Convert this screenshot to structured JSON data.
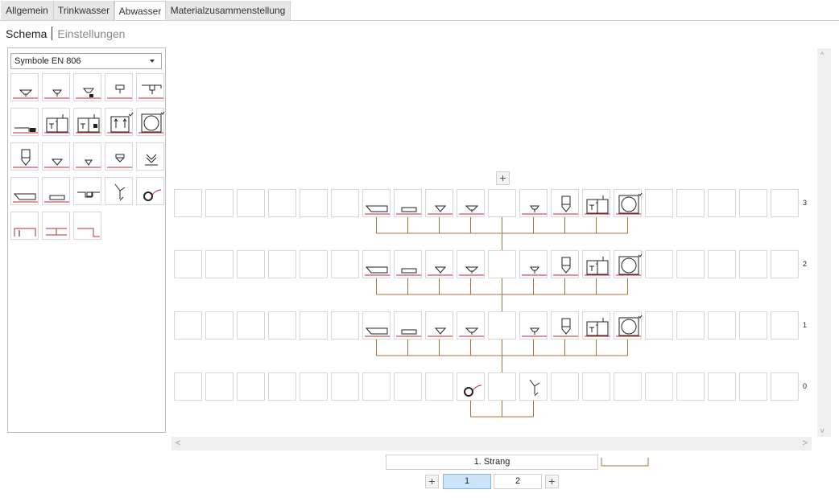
{
  "tabs": [
    {
      "label": "Allgemein",
      "active": false
    },
    {
      "label": "Trinkwasser",
      "active": false
    },
    {
      "label": "Abwasser",
      "active": true
    },
    {
      "label": "Materialzusammenstellung",
      "active": false
    }
  ],
  "subnav": {
    "current": "Schema",
    "other": "Einstellungen"
  },
  "palette": {
    "dropdown_value": "Symbole EN 806",
    "symbols": [
      [
        "washbasin-symbol",
        "small-washbasin-symbol",
        "basin-with-trap-symbol",
        "wall-fixture-symbol",
        "shower-head-symbol"
      ],
      [
        "pipe-outlet-symbol",
        "cabinet-unit-symbol",
        "cabinet-unit-alt-symbol",
        "cabinet-check-symbol",
        "toilet-round-symbol"
      ],
      [
        "urinal-symbol",
        "floor-drain-symbol",
        "floor-drain-small-symbol",
        "funnel-trap-symbol",
        "double-chevron-symbol"
      ],
      [
        "bathtub-symbol",
        "tray-symbol",
        "pipe-step-symbol",
        "branch-pipe-symbol",
        "ring-connector-symbol"
      ],
      [
        "step-up-symbol",
        "tee-symbol",
        "step-down-symbol"
      ]
    ]
  },
  "schema": {
    "floors": [
      {
        "label": "3",
        "fixtures": [
          "bathtub",
          "tray",
          "floor-drain",
          "washbasin",
          "",
          "small-washbasin",
          "urinal",
          "cabinet-unit",
          "toilet-round"
        ]
      },
      {
        "label": "2",
        "fixtures": [
          "bathtub",
          "tray",
          "floor-drain",
          "washbasin",
          "",
          "small-washbasin",
          "urinal",
          "cabinet-unit",
          "toilet-round"
        ]
      },
      {
        "label": "1",
        "fixtures": [
          "bathtub",
          "tray",
          "floor-drain",
          "washbasin",
          "",
          "small-washbasin",
          "urinal",
          "cabinet-unit",
          "toilet-round"
        ]
      },
      {
        "label": "0",
        "fixtures": [
          "",
          "",
          "",
          "ring-connector",
          "",
          "branch-pipe",
          "",
          "",
          ""
        ]
      }
    ],
    "add_floor_label": "+",
    "scroll_up_arrow": "^",
    "scroll_down_arrow": "v",
    "scroll_left_arrow": "<",
    "scroll_right_arrow": ">"
  },
  "strang": {
    "name": "1. Strang"
  },
  "pagination": {
    "add_left": "+",
    "add_right": "+",
    "pages": [
      "1",
      "2"
    ],
    "selected": "1"
  },
  "colors": {
    "pipe": "#a5713f",
    "accent_red": "#c8262b",
    "tab_active_bg": "#ffffff",
    "page_selected": "#cde3f7"
  }
}
